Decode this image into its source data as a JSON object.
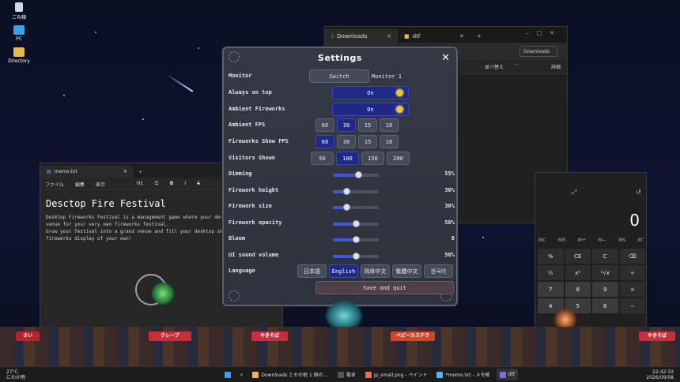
{
  "desktop": {
    "icons": [
      {
        "label": "ごみ箱",
        "icon": "recycle-bin-icon"
      },
      {
        "label": "PC",
        "icon": "monitor-icon"
      },
      {
        "label": "Directory",
        "icon": "folder-icon"
      }
    ]
  },
  "explorer": {
    "tabs": [
      {
        "label": "Downloads",
        "icon": "download-icon"
      },
      {
        "label": "dtf",
        "icon": "folder-icon"
      }
    ],
    "search_placeholder": "Downloads",
    "toolbar_sort": "並べ替え",
    "toolbar_more": "···",
    "toolbar_details": "詳細"
  },
  "notepad": {
    "tab_title": "memo.txt",
    "menu": [
      "ファイル",
      "編集",
      "表示"
    ],
    "heading_style": "H1",
    "title": "Desctop Fire Festival",
    "body": "Desktop Fireworks Festival is a management game where your desk\nvenue for your very own fireworks festival.\nGrow your festival into a grand venue and fill your desktop sk\nfireworks display of your own!"
  },
  "calculator": {
    "display": "0",
    "memory": [
      "MC",
      "MR",
      "M+",
      "M−",
      "MS",
      "M˅"
    ],
    "keys": [
      "%",
      "CE",
      "C",
      "⌫",
      "¹⁄ₓ",
      "x²",
      "²√x",
      "÷",
      "7",
      "8",
      "9",
      "×",
      "4",
      "5",
      "6",
      "−"
    ]
  },
  "settings": {
    "title": "Settings",
    "close": "✕",
    "rows": {
      "monitor": {
        "label": "Monitor",
        "button": "Switch",
        "value": "Monitor 1"
      },
      "always_on_top": {
        "label": "Always on top",
        "state": "On"
      },
      "ambient_fireworks": {
        "label": "Ambient Fireworks",
        "state": "On"
      },
      "ambient_fps": {
        "label": "Ambient FPS",
        "options": [
          "60",
          "30",
          "15",
          "10"
        ],
        "selected": "30"
      },
      "show_fps": {
        "label": "Fireworks Show FPS",
        "options": [
          "60",
          "30",
          "15",
          "10"
        ],
        "selected": "60"
      },
      "visitors": {
        "label": "Visitors Shown",
        "options": [
          "50",
          "100",
          "150",
          "200"
        ],
        "selected": "100"
      },
      "dimming": {
        "label": "Dimming",
        "value": "55%",
        "level": 0.55
      },
      "firework_height": {
        "label": "Firework height",
        "value": "30%",
        "level": 0.3
      },
      "firework_size": {
        "label": "Firework size",
        "value": "30%",
        "level": 0.3
      },
      "firework_opacity": {
        "label": "Firework opacity",
        "value": "50%",
        "level": 0.5
      },
      "bloom": {
        "label": "Bloom",
        "value": "8",
        "level": 0.5
      },
      "ui_sound_volume": {
        "label": "UI sound volume",
        "value": "50%",
        "level": 0.5
      },
      "language": {
        "label": "Language",
        "options": [
          "日本語",
          "English",
          "简体中文",
          "繁體中文",
          "한국어"
        ],
        "selected": "English"
      }
    },
    "save": "Save and quit"
  },
  "stalls": [
    "さい",
    "クレープ",
    "やきそば",
    "ベビーカステラ",
    "やきそば"
  ],
  "taskbar": {
    "weather_temp": "27°C",
    "weather_text": "にわか雨",
    "apps": [
      "Downloads とその他 1 個の…",
      "電卓",
      "jp_small.png - ペイント",
      "*memo.txt - メモ帳",
      "dtf"
    ],
    "time": "22:42:33",
    "date": "2026/09/08"
  },
  "colors": {
    "selected": "#1f2a86",
    "slider_fill": "#3f59d6",
    "sun": "#f0c23a",
    "dialog_bg": "#353945"
  }
}
